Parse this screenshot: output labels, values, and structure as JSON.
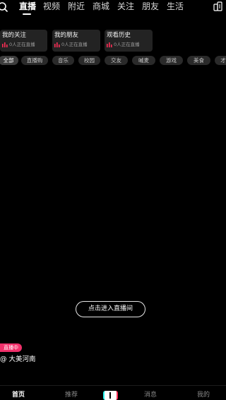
{
  "topnav": {
    "tabs": [
      {
        "label": "直播",
        "active": true
      },
      {
        "label": "视频"
      },
      {
        "label": "附近"
      },
      {
        "label": "商城"
      },
      {
        "label": "关注"
      },
      {
        "label": "朋友"
      },
      {
        "label": "生活"
      }
    ],
    "icons": [
      "search-icon",
      "fullscreen-icon"
    ]
  },
  "cards": [
    {
      "title": "我的关注",
      "subtitle": "0人正在直播"
    },
    {
      "title": "我的朋友",
      "subtitle": "0人正在直播"
    },
    {
      "title": "观看历史",
      "subtitle": "0人正在直播"
    }
  ],
  "chips": [
    "全部",
    "直播购",
    "音乐",
    "校园",
    "交友",
    "喊麦",
    "游戏",
    "美食",
    "才"
  ],
  "player": {
    "enter_label": "点击进入直播间",
    "live_badge": "直播中",
    "host": "@ 大美河南"
  },
  "bottomnav": {
    "items": [
      "首页",
      "推荐",
      "消息",
      "我的"
    ]
  },
  "colors": {
    "background": "#000000",
    "live_badge": "#f0306a",
    "live_bars": "#ff2d55"
  }
}
